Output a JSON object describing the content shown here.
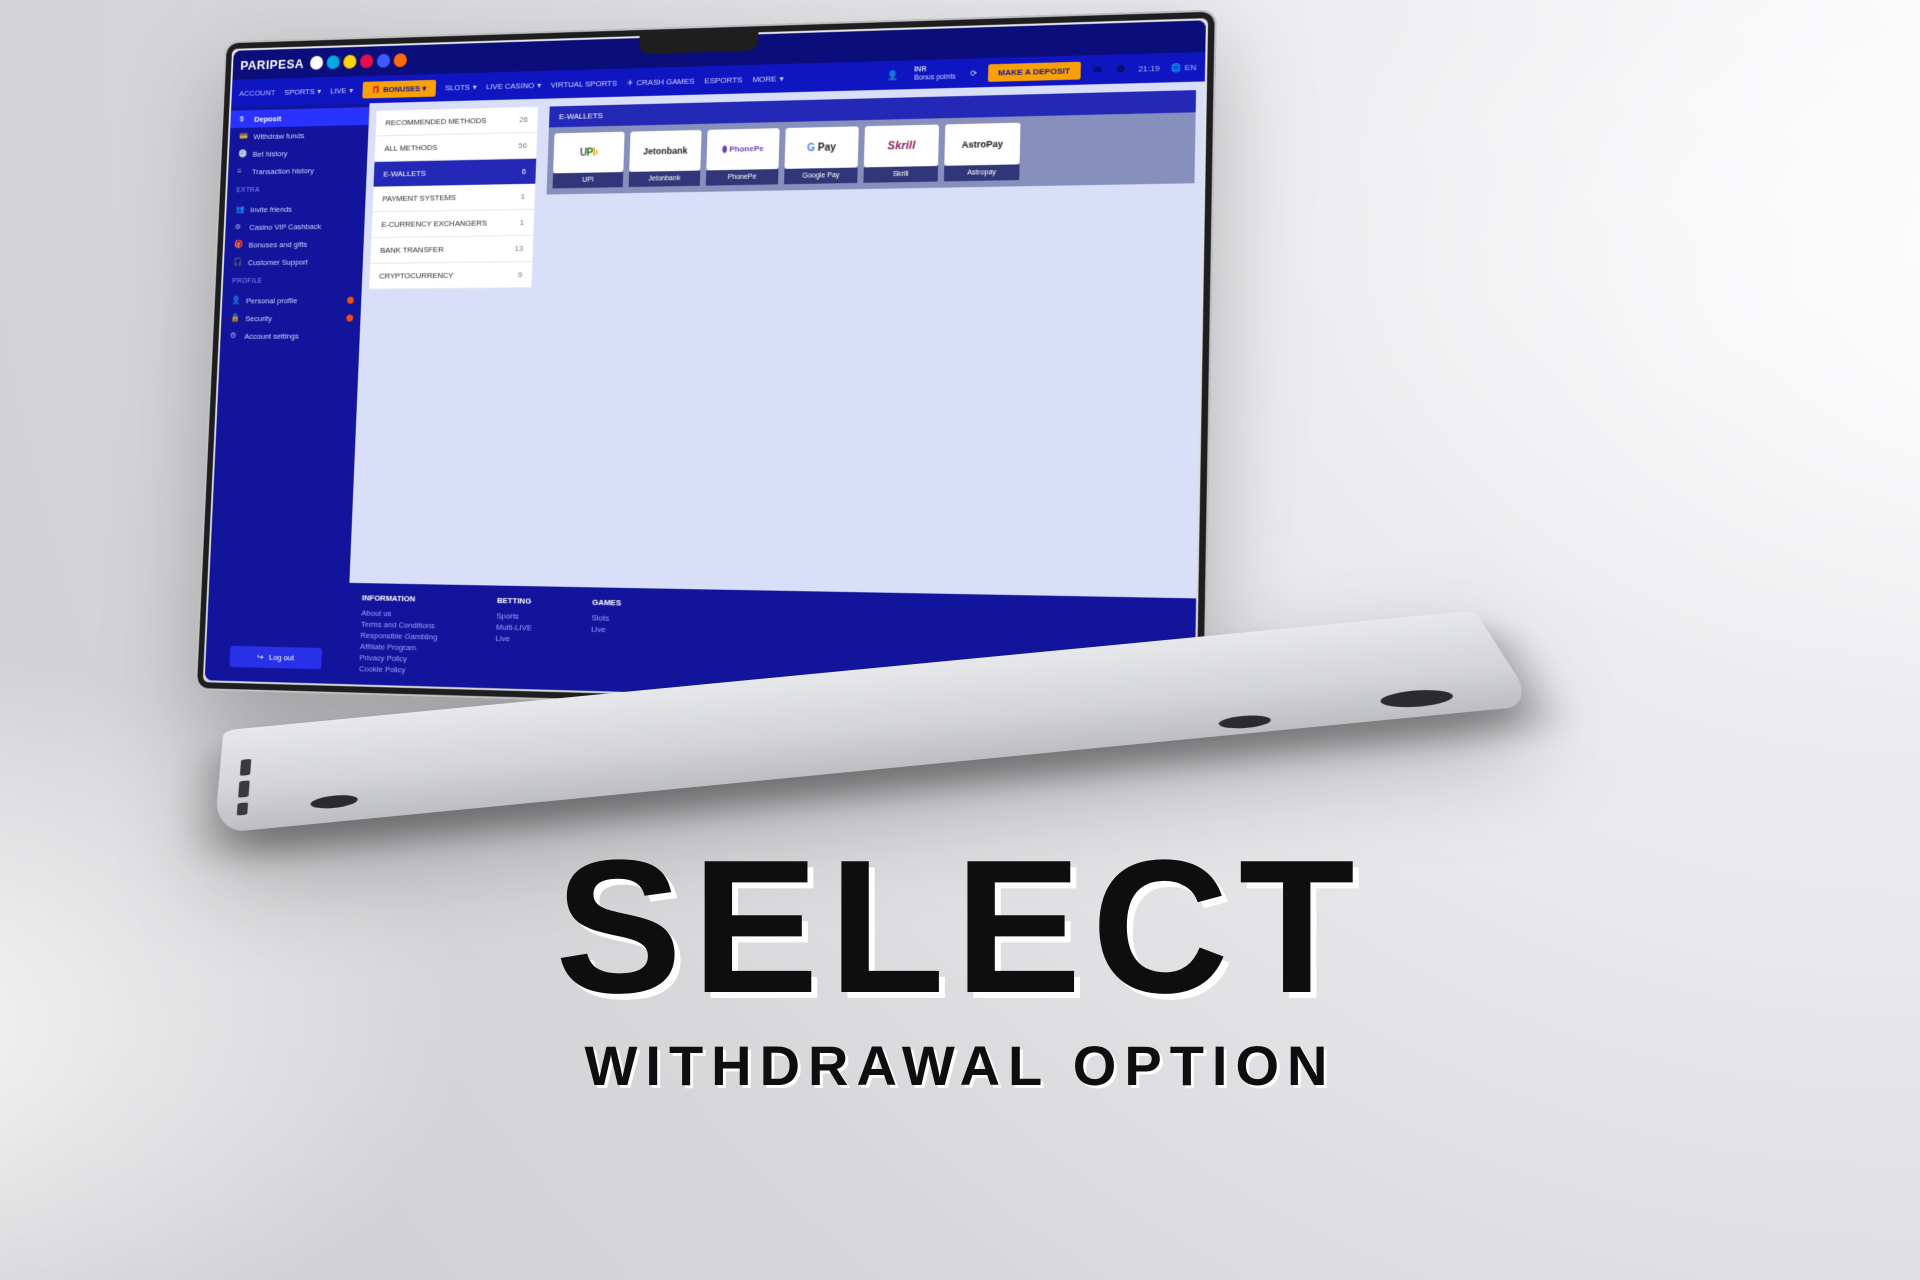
{
  "caption": {
    "big": "SELECT",
    "sub": "WITHDRAWAL OPTION"
  },
  "brand": "PARIPESA",
  "topnav_simple": {
    "sports": "SPORTS",
    "live": "LIVE"
  },
  "nav": {
    "bonuses": "BONUSES",
    "slots": "SLOTS",
    "live_casino": "LIVE CASINO",
    "virtual": "VIRTUAL SPORTS",
    "crash": "CRASH GAMES",
    "esports": "ESPORTS",
    "more": "MORE"
  },
  "header": {
    "currency": "INR",
    "bonus_lbl": "Bonus points",
    "deposit_btn": "MAKE A DEPOSIT",
    "time": "21:19",
    "lang": "EN"
  },
  "sidebar": {
    "account_head": "ACCOUNT",
    "deposit": "Deposit",
    "withdraw": "Withdraw funds",
    "bethistory": "Bet history",
    "txnhistory": "Transaction history",
    "extra_head": "EXTRA",
    "invite": "Invite friends",
    "vip": "Casino VIP Cashback",
    "bonuses": "Bonuses and gifts",
    "support": "Customer Support",
    "profile_head": "PROFILE",
    "personal": "Personal profile",
    "security": "Security",
    "settings": "Account settings",
    "logout": "Log out"
  },
  "categories": [
    {
      "label": "RECOMMENDED METHODS",
      "count": "26"
    },
    {
      "label": "ALL METHODS",
      "count": "56"
    },
    {
      "label": "E-WALLETS",
      "count": "6",
      "active": true
    },
    {
      "label": "PAYMENT SYSTEMS",
      "count": "1"
    },
    {
      "label": "E-CURRENCY EXCHANGERS",
      "count": "1"
    },
    {
      "label": "BANK TRANSFER",
      "count": "13"
    },
    {
      "label": "CRYPTOCURRENCY",
      "count": "9"
    }
  ],
  "wallets": {
    "header": "E-WALLETS",
    "items": [
      {
        "name": "UPI",
        "logo": "UPI"
      },
      {
        "name": "Jetonbank",
        "logo": "Jetonbank"
      },
      {
        "name": "PhonePe",
        "logo": "PhonePe"
      },
      {
        "name": "Google Pay",
        "logo": "G Pay"
      },
      {
        "name": "Skrill",
        "logo": "Skrill"
      },
      {
        "name": "Astropay",
        "logo": "AstroPay"
      }
    ]
  },
  "footer": {
    "info_h": "INFORMATION",
    "info": [
      "About us",
      "Terms and Conditions",
      "Responsible Gambling",
      "Affiliate Program",
      "Privacy Policy",
      "Cookie Policy"
    ],
    "bet_h": "BETTING",
    "bet": [
      "Sports",
      "Multi-LIVE",
      "Live"
    ],
    "games_h": "GAMES",
    "games": [
      "Slots",
      "Live"
    ]
  }
}
